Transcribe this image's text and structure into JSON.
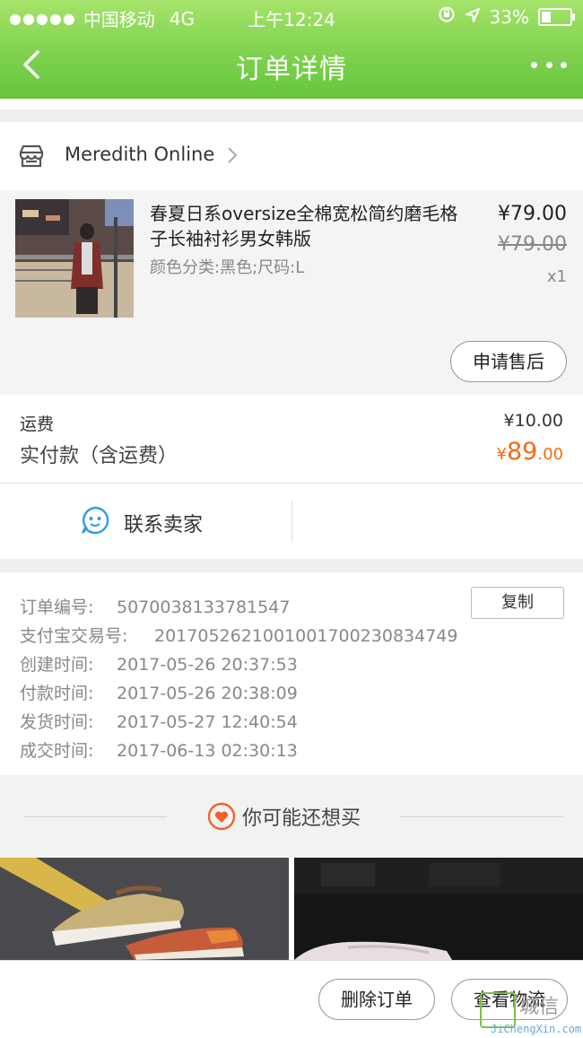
{
  "status_bar": {
    "signal_dots": "●●●●●",
    "carrier": "中国移动",
    "network": "4G",
    "time": "上午12:24",
    "battery": "33%"
  },
  "nav": {
    "title": "订单详情"
  },
  "shop": {
    "name": "Meredith Online"
  },
  "product": {
    "title": "春夏日系oversize全棉宽松简约磨毛格子长袖衬衫男女韩版",
    "sku": "颜色分类:黑色;尺码:L",
    "price": "¥79.00",
    "original_price": "¥79.00",
    "quantity": "x1",
    "after_sale_label": "申请售后"
  },
  "costs": {
    "shipping_label": "运费",
    "shipping_value": "¥10.00",
    "paid_label": "实付款（含运费）",
    "paid_currency": "¥",
    "paid_integer": "89",
    "paid_decimal": ".00"
  },
  "contact": {
    "label": "联系卖家"
  },
  "order_info": {
    "copy_label": "复制",
    "rows": [
      {
        "label": "订单编号:",
        "value": "5070038133781547"
      },
      {
        "label": "支付宝交易号:",
        "value": "2017052621001001700230834749"
      },
      {
        "label": "创建时间:",
        "value": "2017-05-26 20:37:53"
      },
      {
        "label": "付款时间:",
        "value": "2017-05-26 20:38:09"
      },
      {
        "label": "发货时间:",
        "value": "2017-05-27 12:40:54"
      },
      {
        "label": "成交时间:",
        "value": "2017-06-13 02:30:13"
      }
    ]
  },
  "recommend": {
    "title": "你可能还想买"
  },
  "actions": {
    "delete_label": "删除订单",
    "logistics_label": "查看物流"
  },
  "watermark": {
    "text": "城信",
    "sub": "JiChengXin.com"
  },
  "colors": {
    "header_green": "#7fd24f",
    "price_orange": "#f36b12",
    "contact_blue": "#2f9be8",
    "recommend_orange": "#f2622e"
  }
}
